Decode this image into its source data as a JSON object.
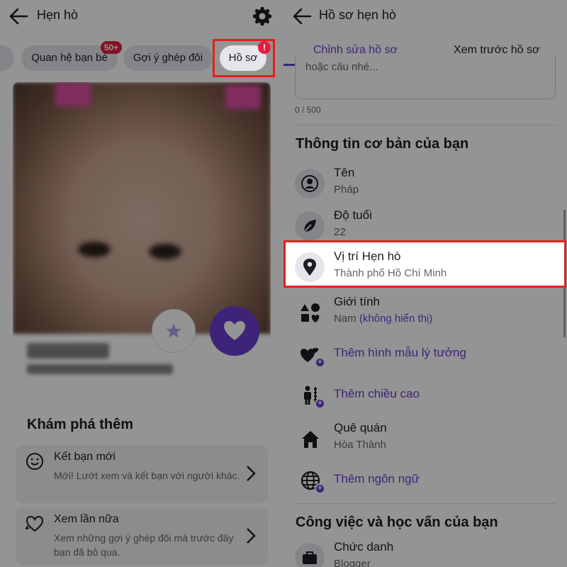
{
  "left": {
    "header": {
      "title": "Hẹn hò"
    },
    "chips": [
      {
        "label": "Quan hệ bạn bè",
        "badge": "50+"
      },
      {
        "label": "Gợi ý ghép đôi"
      },
      {
        "label": "Hồ sơ",
        "badge": "!"
      }
    ],
    "explore": {
      "title": "Khám phá thêm",
      "items": [
        {
          "title": "Kết bạn mới",
          "desc": "Mới! Lướt xem và kết bạn với người khác."
        },
        {
          "title": "Xem lần nữa",
          "desc": "Xem những gợi ý ghép đôi mà trước đây bạn đã bỏ qua."
        }
      ]
    }
  },
  "right": {
    "header": {
      "title": "Hồ sơ hẹn hò"
    },
    "tabs": [
      {
        "label": "Chỉnh sửa hồ sơ",
        "active": true
      },
      {
        "label": "Xem trước hồ sơ",
        "active": false
      }
    ],
    "bio": {
      "placeholder_tail": "hoặc câu nhé...",
      "counter": "0 / 500"
    },
    "basic_info": {
      "title": "Thông tin cơ bản của bạn",
      "name": {
        "label": "Tên",
        "value": "Pháp"
      },
      "age": {
        "label": "Độ tuổi",
        "value": "22"
      },
      "location": {
        "label": "Vị trí Hẹn hò",
        "value": "Thành phố Hồ Chí Minh"
      },
      "gender": {
        "label": "Giới tính",
        "value": "Nam",
        "note": "(không hiển thị)"
      },
      "add_ideal": "Thêm hình mẫu lý tưởng",
      "add_height": "Thêm chiều cao",
      "hometown": {
        "label": "Quê quán",
        "value": "Hòa Thành"
      },
      "add_language": "Thêm ngôn ngữ"
    },
    "work": {
      "title": "Công việc và học vấn của bạn",
      "job": {
        "label": "Chức danh",
        "value": "Blogger"
      }
    }
  },
  "colors": {
    "accent": "#6b3fd0",
    "highlight": "#e0211b",
    "badge": "#e41e3f"
  }
}
